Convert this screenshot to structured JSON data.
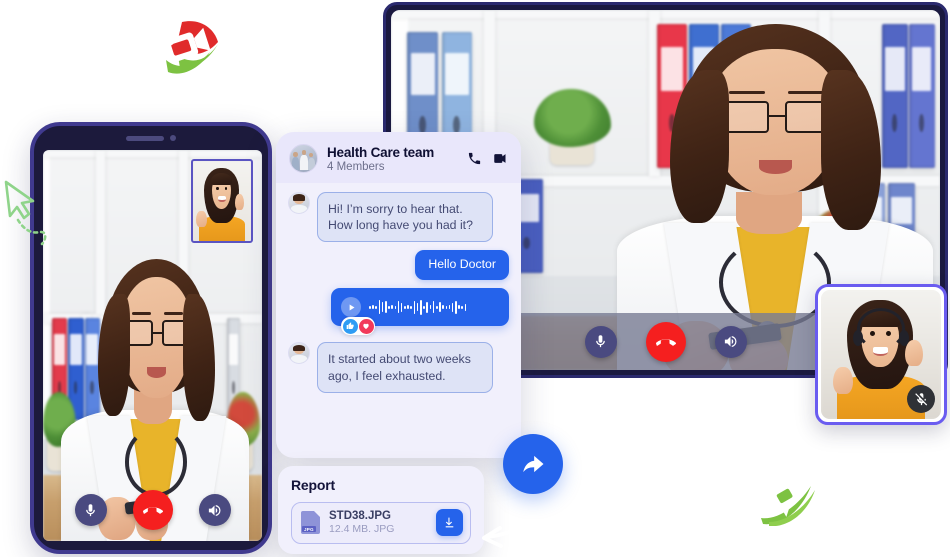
{
  "chat": {
    "title": "Health Care team",
    "members": "4 Members",
    "avatar_icon": "team-avatar",
    "call_icon": "phone-icon",
    "video_icon": "video-camera-icon",
    "messages": [
      {
        "id": "m1",
        "direction": "incoming",
        "type": "text",
        "text": "Hi! I’m sorry to hear that. How long have you had it?"
      },
      {
        "id": "m2",
        "direction": "outgoing",
        "type": "text",
        "text": "Hello  Doctor"
      },
      {
        "id": "m3",
        "direction": "outgoing",
        "type": "voice",
        "play_icon": "play-icon",
        "reactions": [
          "thumbs-up-icon",
          "heart-icon"
        ]
      },
      {
        "id": "m4",
        "direction": "incoming",
        "type": "text",
        "text": "It started about two weeks ago, I feel exhausted."
      }
    ]
  },
  "report": {
    "title": "Report",
    "file_name": "STD38.JPG",
    "file_size": "12.4 MB. JPG",
    "file_type_tag": "JPG",
    "file_icon": "jpg-file-icon",
    "download_icon": "download-icon"
  },
  "share": {
    "icon": "share-arrow-icon",
    "label": "Share"
  },
  "laptop_call": {
    "controls": [
      {
        "id": "mic",
        "icon": "microphone-icon",
        "label": "Mute"
      },
      {
        "id": "end",
        "icon": "end-call-icon",
        "label": "End call"
      },
      {
        "id": "speaker",
        "icon": "speaker-icon",
        "label": "Speaker"
      }
    ]
  },
  "phone_call": {
    "controls": [
      {
        "id": "mic",
        "icon": "microphone-icon",
        "label": "Mute"
      },
      {
        "id": "end",
        "icon": "end-call-icon",
        "label": "End call"
      },
      {
        "id": "speaker",
        "icon": "speaker-icon",
        "label": "Speaker"
      }
    ]
  },
  "pip_panel": {
    "badge_icon": "mic-muted-icon"
  },
  "decorations": [
    {
      "id": "video-sticker",
      "icon": "video-camera-sticker",
      "colors": [
        "#e02b2b",
        "#7dc242"
      ]
    },
    {
      "id": "chat-sticker",
      "icon": "chat-bubble-sticker",
      "colors": [
        "#7dc242"
      ]
    },
    {
      "id": "cursor",
      "icon": "cursor-arrow-icon",
      "colors": [
        "#8fd48a"
      ]
    }
  ],
  "colors": {
    "accent_blue": "#2563eb",
    "end_call_red": "#f51f1f",
    "panel_lavender": "#f1f0fc",
    "bubble_in": "#dee3f6",
    "frame_purple": "#403a8f",
    "dark_navy": "#14143a"
  }
}
